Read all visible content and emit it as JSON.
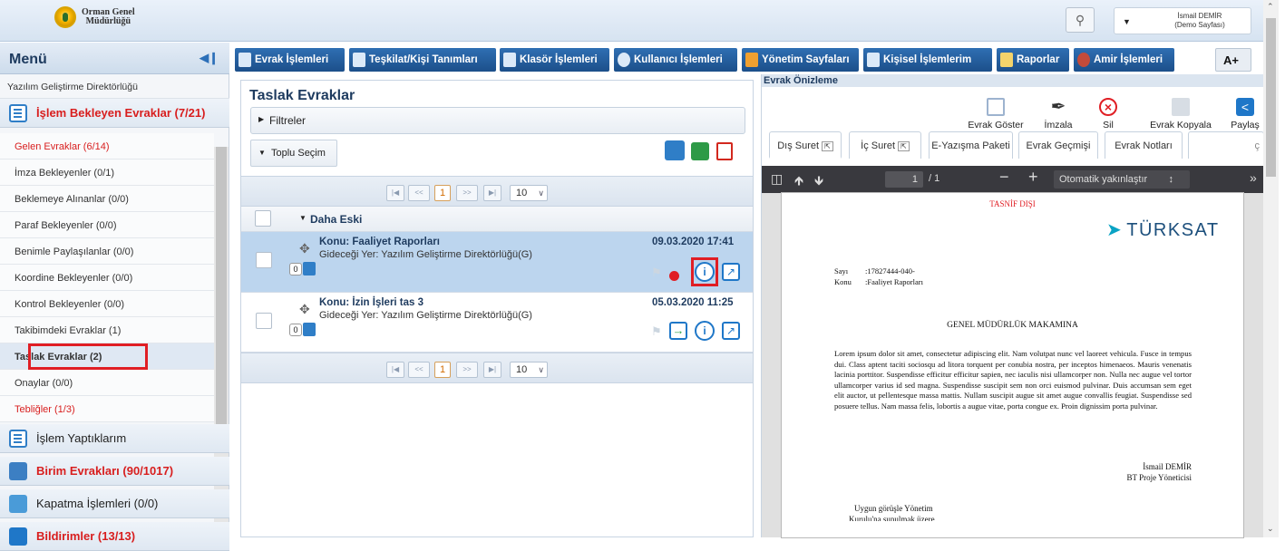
{
  "header": {
    "logo_line1": "Orman Genel",
    "logo_line2": "Müdürlüğü",
    "user_name": "İsmail DEMİR",
    "user_role": "(Demo Sayfası)"
  },
  "sidebar": {
    "title": "Menü",
    "org": "Yazılım Geliştirme Direktörlüğü",
    "section_pending": "İşlem Bekleyen Evraklar (7/21)",
    "items": [
      {
        "label": "Gelen Evraklar (6/14)",
        "red": true
      },
      {
        "label": "İmza Bekleyenler (0/1)",
        "red": false
      },
      {
        "label": "Beklemeye Alınanlar (0/0)",
        "red": false
      },
      {
        "label": "Paraf Bekleyenler (0/0)",
        "red": false
      },
      {
        "label": "Benimle Paylaşılanlar (0/0)",
        "red": false
      },
      {
        "label": "Koordine Bekleyenler (0/0)",
        "red": false
      },
      {
        "label": "Kontrol Bekleyenler (0/0)",
        "red": false
      },
      {
        "label": "Takibimdeki Evraklar (1)",
        "red": false
      },
      {
        "label": "Taslak Evraklar (2)",
        "red": false
      },
      {
        "label": "Onaylar (0/0)",
        "red": false
      },
      {
        "label": "Tebliğler (1/3)",
        "red": true
      }
    ],
    "section_done": "İşlem Yaptıklarım",
    "section_unit": "Birim Evrakları (90/1017)",
    "section_close": "Kapatma İşlemleri (0/0)",
    "section_notif": "Bildirimler (13/13)"
  },
  "toolbar": {
    "items": [
      "Evrak İşlemleri",
      "Teşkilat/Kişi Tanımları",
      "Klasör İşlemleri",
      "Kullanıcı İşlemleri",
      "Yönetim Sayfaları",
      "Kişisel İşlemlerim",
      "Raporlar",
      "Amir İşlemleri"
    ],
    "font_plus": "A+"
  },
  "drafts": {
    "title": "Taslak Evraklar",
    "filters": "Filtreler",
    "bulk": "Toplu Seçim",
    "page": "1",
    "page_size": "10",
    "group": "Daha Eski",
    "rows": [
      {
        "subject": "Konu: Faaliyet Raporları",
        "recipient": "Gideceği Yer: Yazılım Geliştirme Direktörlüğü(G)",
        "date": "09.03.2020 17:41",
        "count": "0"
      },
      {
        "subject": "Konu: İzin İşleri tas 3",
        "recipient": "Gideceği Yer: Yazılım Geliştirme Direktörlüğü(G)",
        "date": "05.03.2020 11:25",
        "count": "0"
      }
    ]
  },
  "preview": {
    "title": "Evrak Önizleme",
    "actions": [
      "Evrak Göster",
      "İmzala",
      "Sil",
      "Evrak Kopyala",
      "Paylaş"
    ],
    "tabs": [
      "Dış Suret",
      "İç Suret",
      "E-Yazışma Paketi",
      "Evrak Geçmişi",
      "Evrak Notları"
    ],
    "pdf_page": "1",
    "pdf_total": "/ 1",
    "pdf_zoom": "Otomatik yakınlaştır",
    "doc": {
      "classification": "TASNİF DIŞI",
      "brand": "TÜRKSAT",
      "sayi_label": "Sayı",
      "sayi_value": ":17827444-040-",
      "konu_label": "Konu",
      "konu_value": ":Faaliyet Raporları",
      "addressee": "GENEL MÜDÜRLÜK MAKAMINA",
      "body": "Lorem ipsum dolor sit amet, consectetur adipiscing elit. Nam volutpat nunc vel laoreet vehicula. Fusce in tempus dui. Class aptent taciti sociosqu ad litora torquent per conubia nostra, per inceptos himenaeos. Mauris venenatis lacinia porttitor. Suspendisse efficitur efficitur sapien, nec iaculis nisi ullamcorper non. Nulla nec augue vel tortor ullamcorper varius id sed magna. Suspendisse suscipit sem non orci euismod pulvinar. Duis accumsan sem eget elit auctor, ut pellentesque massa mattis. Nullam suscipit augue sit amet augue convallis feugiat. Suspendisse sed posuere tellus. Nam massa felis, lobortis a augue vitae, porta congue ex. Proin dignissim porta pulvinar.",
      "signer": "İsmail DEMİR",
      "signer_title": "BT Proje Yöneticisi",
      "approval": "Uygun görüşle Yönetim",
      "approval2": "Kurulu'na sunulmak üzere"
    }
  },
  "colors": {
    "accent": "#1f5a99",
    "alert": "#e01e24"
  }
}
